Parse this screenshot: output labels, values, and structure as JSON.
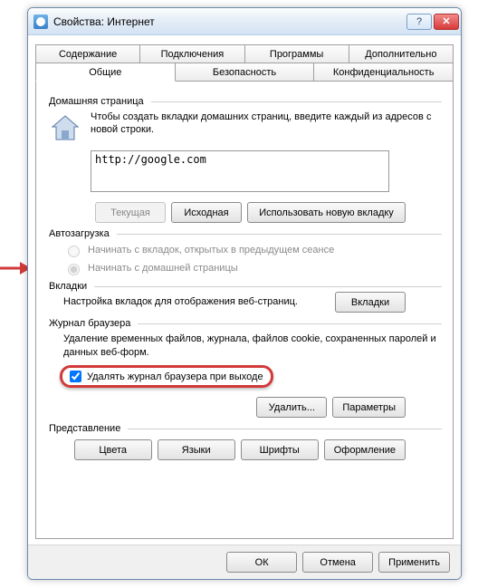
{
  "window": {
    "title": "Свойства: Интернет"
  },
  "tabs_row1": [
    {
      "label": "Содержание"
    },
    {
      "label": "Подключения"
    },
    {
      "label": "Программы"
    },
    {
      "label": "Дополнительно"
    }
  ],
  "tabs_row2": [
    {
      "label": "Общие",
      "active": true
    },
    {
      "label": "Безопасность"
    },
    {
      "label": "Конфиденциальность"
    }
  ],
  "homepage": {
    "group": "Домашняя страница",
    "hint": "Чтобы создать вкладки домашних страниц, введите каждый из адресов с новой строки.",
    "url": "http://google.com",
    "btn_current": "Текущая",
    "btn_default": "Исходная",
    "btn_newtab": "Использовать новую вкладку"
  },
  "startup": {
    "group": "Автозагрузка",
    "opt_tabs": "Начинать с вкладок, открытых в предыдущем сеансе",
    "opt_home": "Начинать с домашней страницы"
  },
  "tabs_section": {
    "group": "Вкладки",
    "desc": "Настройка вкладок для отображения веб-страниц.",
    "btn": "Вкладки"
  },
  "history": {
    "group": "Журнал браузера",
    "desc": "Удаление временных файлов, журнала, файлов cookie, сохраненных паролей и данных веб-форм.",
    "chk": "Удалять журнал браузера при выходе",
    "btn_delete": "Удалить...",
    "btn_params": "Параметры"
  },
  "appearance": {
    "group": "Представление",
    "btn_colors": "Цвета",
    "btn_langs": "Языки",
    "btn_fonts": "Шрифты",
    "btn_style": "Оформление"
  },
  "footer": {
    "ok": "ОК",
    "cancel": "Отмена",
    "apply": "Применить"
  }
}
